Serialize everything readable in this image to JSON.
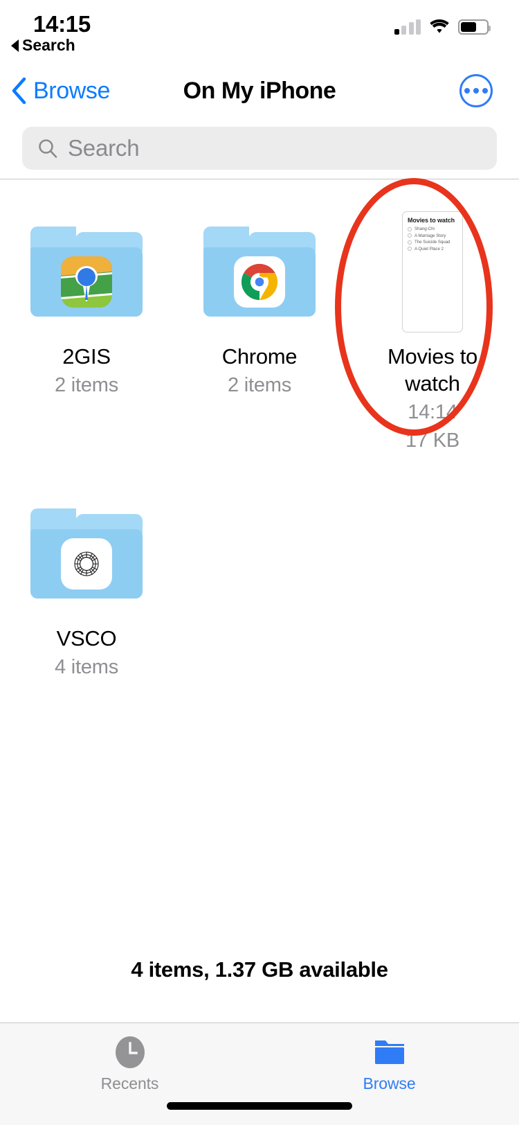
{
  "status_bar": {
    "time": "14:15",
    "return_label": "Search",
    "return_icon": "back-triangle-icon",
    "signal_icon": "cellular-signal-icon",
    "signal_bars_on": 1,
    "signal_bars_total": 4,
    "wifi_icon": "wifi-icon",
    "battery_icon": "battery-icon",
    "battery_level_percent": 62
  },
  "nav_bar": {
    "back_label": "Browse",
    "back_icon": "chevron-left-icon",
    "title": "On My iPhone",
    "more_icon": "ellipsis-circle-icon"
  },
  "search": {
    "placeholder": "Search",
    "value": "",
    "icon": "search-icon"
  },
  "grid": {
    "items": [
      {
        "kind": "folder",
        "name": "2GIS",
        "meta": "2 items",
        "icon": "2gis-app-icon"
      },
      {
        "kind": "folder",
        "name": "Chrome",
        "meta": "2 items",
        "icon": "chrome-app-icon"
      },
      {
        "kind": "document",
        "name": "Movies to watch",
        "meta_time": "14:14",
        "meta_size": "17 KB",
        "icon": "document-thumbnail",
        "highlighted": true,
        "preview": {
          "title": "Movies to watch",
          "items": [
            "Shang-Chi",
            "A Marriage Story",
            "The Suicide Squad",
            "A Quiet Place 2"
          ]
        }
      },
      {
        "kind": "folder",
        "name": "VSCO",
        "meta": "4 items",
        "icon": "vsco-app-icon"
      }
    ]
  },
  "footer": {
    "status": "4 items, 1.37 GB available"
  },
  "tab_bar": {
    "tabs": [
      {
        "label": "Recents",
        "icon": "clock-icon",
        "active": false
      },
      {
        "label": "Browse",
        "icon": "folder-icon",
        "active": true
      }
    ]
  },
  "colors": {
    "accent_blue": "#2f7cf6",
    "link_blue": "#0a7cff",
    "annotation_red": "#e8341c",
    "folder_blue": "#8ecdf2",
    "folder_tab_blue": "#a3d8f6",
    "secondary_text": "#8e8e93",
    "search_background": "#ececed"
  }
}
